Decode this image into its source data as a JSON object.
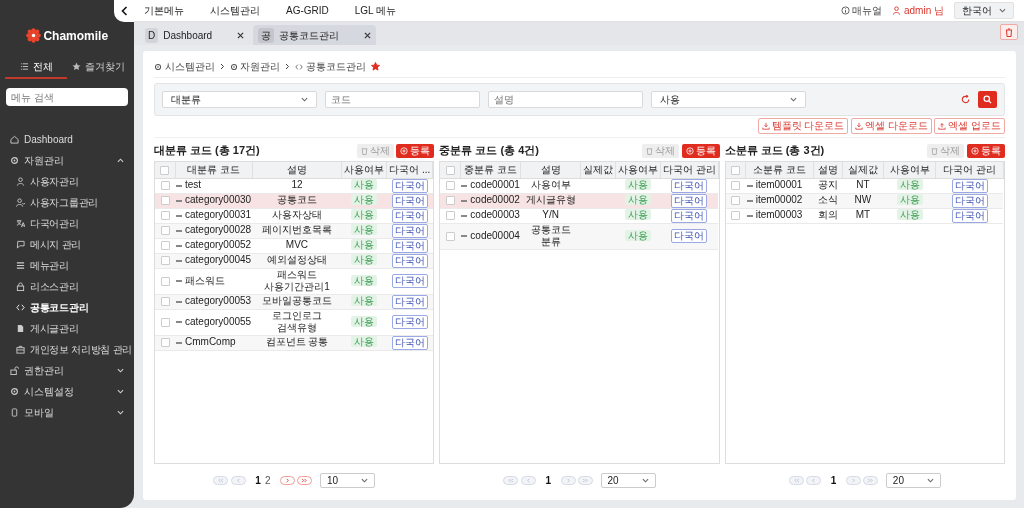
{
  "sidebar": {
    "logo": "Chamomile",
    "tabs": [
      {
        "label": "전체",
        "selected": true
      },
      {
        "label": "즐겨찾기",
        "selected": false
      }
    ],
    "search": {
      "placeholder": "메뉴 검색"
    },
    "items": [
      {
        "label": "Dashboard",
        "selected": false
      },
      {
        "label": "자원관리",
        "expanded": true,
        "selected": false,
        "children": [
          {
            "label": "사용자관리",
            "selected": false
          },
          {
            "label": "사용자그룹관리",
            "selected": false
          },
          {
            "label": "다국어관리",
            "selected": false
          },
          {
            "label": "메시지 관리",
            "selected": false
          },
          {
            "label": "메뉴관리",
            "selected": false
          },
          {
            "label": "리소스관리",
            "selected": false
          },
          {
            "label": "공통코드관리",
            "selected": true
          },
          {
            "label": "게시글관리",
            "selected": false
          },
          {
            "label": "개인정보 처리방침 관리",
            "selected": false
          }
        ]
      },
      {
        "label": "권한관리",
        "expanded": false,
        "selected": false
      },
      {
        "label": "시스템설정",
        "expanded": false,
        "selected": false
      },
      {
        "label": "모바일",
        "expanded": false,
        "selected": false
      }
    ]
  },
  "topbar": {
    "menus": [
      "기본메뉴",
      "시스템관리",
      "AG-GRID",
      "LGL 메뉴"
    ],
    "manual": "매뉴얼",
    "user": "admin 님",
    "language": "한국어"
  },
  "tabs": [
    {
      "badge": "D",
      "label": "Dashboard",
      "selected": false
    },
    {
      "badge": "공",
      "label": "공통코드관리",
      "selected": true
    }
  ],
  "breadcrumb": [
    "시스템관리",
    "자원관리",
    "공통코드관리"
  ],
  "favorite": true,
  "filters": [
    {
      "kind": "select",
      "value": "대분류"
    },
    {
      "kind": "input",
      "placeholder": "코드"
    },
    {
      "kind": "input",
      "placeholder": "설명"
    },
    {
      "kind": "select",
      "value": "사용"
    }
  ],
  "actions": [
    "템플릿 다운로드",
    "엑셀 다운로드",
    "엑셀 업로드"
  ],
  "panels": [
    {
      "title": "대분류 코드 (총 17건)",
      "delete": "삭제",
      "register": "등록",
      "all_checked": false,
      "columns": [
        "대분류 코드",
        "설명",
        "사용여부",
        "다국어 ..."
      ],
      "rows": [
        {
          "cells": [
            "test",
            "12"
          ],
          "use": "사용",
          "lang": "다국어",
          "checked": false,
          "selected": false
        },
        {
          "cells": [
            "category00030",
            "공통코드"
          ],
          "use": "사용",
          "lang": "다국어",
          "checked": false,
          "selected": true
        },
        {
          "cells": [
            "category00031",
            "사용자상태"
          ],
          "use": "사용",
          "lang": "다국어",
          "checked": false,
          "selected": false
        },
        {
          "cells": [
            "category00028",
            "페이지번호목록"
          ],
          "use": "사용",
          "lang": "다국어",
          "checked": false,
          "selected": false
        },
        {
          "cells": [
            "category00052",
            "MVC"
          ],
          "use": "사용",
          "lang": "다국어",
          "checked": false,
          "selected": false
        },
        {
          "cells": [
            "category00045",
            "예외설정상태"
          ],
          "use": "사용",
          "lang": "다국어",
          "checked": false,
          "selected": false
        },
        {
          "cells": [
            "패스워드",
            "패스워드 사용기간관리1"
          ],
          "use": "사용",
          "lang": "다국어",
          "checked": false,
          "selected": false
        },
        {
          "cells": [
            "category00053",
            "모바일공통코드"
          ],
          "use": "사용",
          "lang": "다국어",
          "checked": false,
          "selected": false
        },
        {
          "cells": [
            "category00055",
            "로그인로그 검색유형"
          ],
          "use": "사용",
          "lang": "다국어",
          "checked": false,
          "selected": false
        },
        {
          "cells": [
            "CmmComp",
            "컴포넌트 공통"
          ],
          "use": "사용",
          "lang": "다국어",
          "checked": false,
          "selected": false
        }
      ],
      "pagination": {
        "first_disabled": true,
        "prev_disabled": true,
        "next_disabled": false,
        "last_disabled": false,
        "pages": [
          {
            "label": "1",
            "selected": true
          },
          {
            "label": "2",
            "selected": false
          }
        ],
        "page_size": "10"
      }
    },
    {
      "title": "중분류 코드 (총 4건)",
      "delete": "삭제",
      "register": "등록",
      "all_checked": false,
      "columns": [
        "중분류 코드",
        "설명",
        "실제값",
        "사용여부",
        "다국어 관리"
      ],
      "rows": [
        {
          "cells": [
            "code00001",
            "사용여부",
            ""
          ],
          "use": "사용",
          "lang": "다국어",
          "checked": false,
          "selected": false
        },
        {
          "cells": [
            "code00002",
            "게시글유형",
            ""
          ],
          "use": "사용",
          "lang": "다국어",
          "checked": false,
          "selected": true
        },
        {
          "cells": [
            "code00003",
            "Y/N",
            ""
          ],
          "use": "사용",
          "lang": "다국어",
          "checked": false,
          "selected": false
        },
        {
          "cells": [
            "code00004",
            "공통코드 분류",
            ""
          ],
          "use": "사용",
          "lang": "다국어",
          "checked": false,
          "selected": false
        }
      ],
      "pagination": {
        "first_disabled": true,
        "prev_disabled": true,
        "next_disabled": true,
        "last_disabled": true,
        "pages": [
          {
            "label": "1",
            "selected": true
          }
        ],
        "page_size": "20"
      }
    },
    {
      "title": "소분류 코드 (총 3건)",
      "delete": "삭제",
      "register": "등록",
      "all_checked": false,
      "columns": [
        "소분류 코드",
        "설명",
        "실제값",
        "사용여부",
        "다국어 관리"
      ],
      "rows": [
        {
          "cells": [
            "item00001",
            "공지",
            "NT"
          ],
          "use": "사용",
          "lang": "다국어",
          "checked": false,
          "selected": false
        },
        {
          "cells": [
            "item00002",
            "소식",
            "NW"
          ],
          "use": "사용",
          "lang": "다국어",
          "checked": false,
          "selected": false
        },
        {
          "cells": [
            "item00003",
            "회의",
            "MT"
          ],
          "use": "사용",
          "lang": "다국어",
          "checked": false,
          "selected": false
        }
      ],
      "pagination": {
        "first_disabled": true,
        "prev_disabled": true,
        "next_disabled": true,
        "last_disabled": true,
        "pages": [
          {
            "label": "1",
            "selected": true
          }
        ],
        "page_size": "20"
      }
    }
  ]
}
